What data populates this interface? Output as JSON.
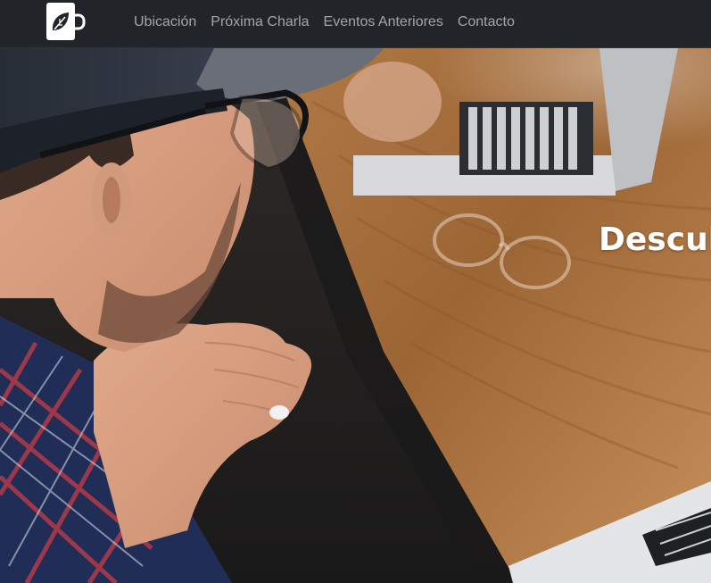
{
  "navbar": {
    "logo_icon": "leaf-mug-icon",
    "links": [
      {
        "label": "Ubicación"
      },
      {
        "label": "Próxima Charla"
      },
      {
        "label": "Eventos Anteriores"
      },
      {
        "label": "Contacto"
      }
    ]
  },
  "hero": {
    "heading": "Descub",
    "image_subject": "man-gesturing-at-laptop-photo"
  },
  "colors": {
    "navbar_bg": "#212529",
    "nav_link": "rgba(255,255,255,0.58)",
    "heading": "#ffffff"
  }
}
